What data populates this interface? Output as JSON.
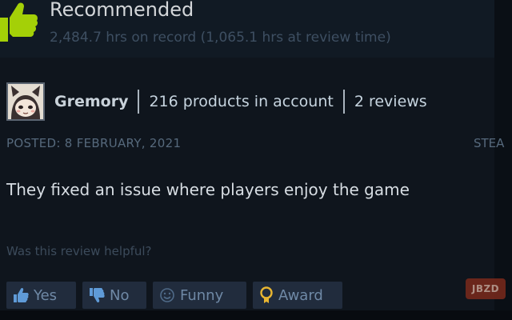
{
  "review": {
    "recommendation": "Recommended",
    "hours": "2,484.7 hrs on record (1,065.1 hrs at review time)",
    "author": {
      "name": "Gremory",
      "products": "216 products in account",
      "reviews": "2 reviews"
    },
    "posted": "POSTED: 8 FEBRUARY, 2021",
    "posted_right": "STEA",
    "text": "They fixed an issue where players enjoy the game"
  },
  "helpful": {
    "prompt": "Was this review helpful?",
    "yes_label": "Yes",
    "no_label": "No",
    "funny_label": "Funny",
    "award_label": "Award"
  },
  "watermark": "JBZD",
  "colors": {
    "accent_green": "#a4d007",
    "panel_bg": "#111a24",
    "button_bg": "#212c3d",
    "button_text": "#6f89a6",
    "award_gold": "#e8b531"
  },
  "icons": {
    "recommend": "thumbs-up-icon",
    "yes": "thumbs-up-icon",
    "no": "thumbs-down-icon",
    "funny": "smiley-icon",
    "award": "award-icon"
  }
}
